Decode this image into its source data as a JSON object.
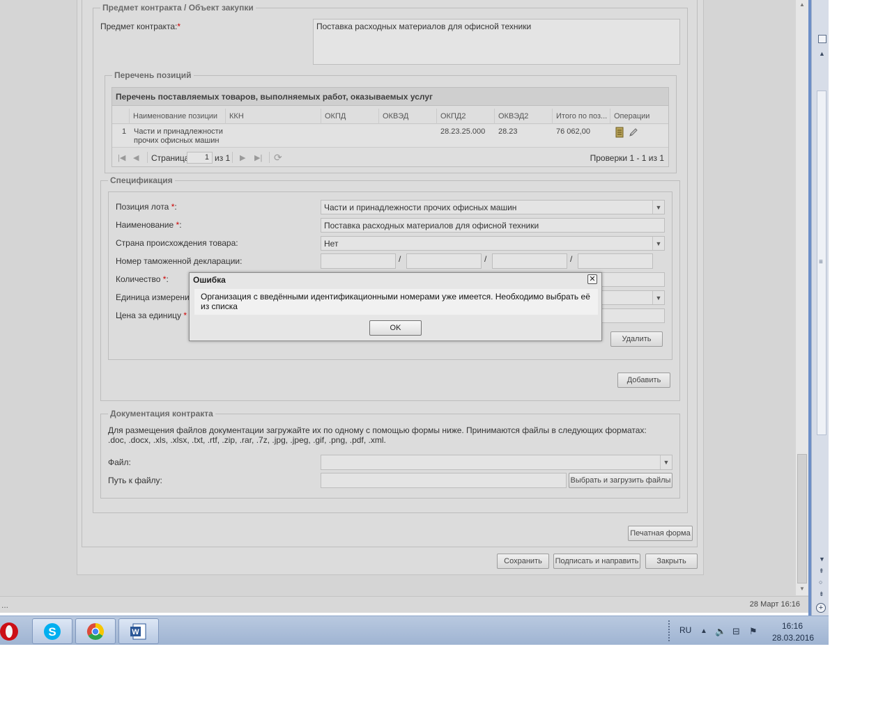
{
  "contract_subject": {
    "legend": "Предмет контракта / Объект закупки",
    "label": "Предмет контракта:",
    "required_mark": "*",
    "value": "Поставка расходных материалов для офисной техники"
  },
  "positions": {
    "legend": "Перечень позиций",
    "grid_title": "Перечень поставляемых товаров, выполняемых работ, оказываемых услуг",
    "columns": [
      "Наименование позиции",
      "ККН",
      "ОКПД",
      "ОКВЭД",
      "ОКПД2",
      "ОКВЭД2",
      "Итого по поз...",
      "Операции"
    ],
    "rows": [
      {
        "num": "1",
        "name_line1": "Части и принадлежности",
        "name_line2": "прочих офисных машин",
        "kkn": "",
        "okpd": "",
        "okved": "",
        "okpd2": "28.23.25.000",
        "okved2": "28.23",
        "total": "76 062,00"
      }
    ],
    "pager": {
      "page_label": "Страница",
      "page_value": "1",
      "of_label": "из 1",
      "summary": "Проверки 1 - 1 из 1"
    }
  },
  "spec": {
    "legend": "Спецификация",
    "lot_position_label": "Позиция лота",
    "lot_position_value": "Части и принадлежности прочих офисных машин",
    "name_label": "Наименование",
    "name_value": "Поставка расходных материалов для офисной техники",
    "country_label": "Страна происхождения товара:",
    "country_value": "Нет",
    "customs_label": "Номер таможенной декларации:",
    "customs_separator": "/",
    "quantity_label": "Количество",
    "unit_label": "Единица измерени",
    "price_label": "Цена за единицу",
    "delete_button": "Удалить",
    "add_button": "Добавить",
    "colon": ":",
    "required_mark": "*"
  },
  "docs": {
    "legend": "Документация контракта",
    "info_line1": "Для размещения файлов документации загружайте их по одному с помощью формы ниже. Принимаются файлы в следующих форматах:",
    "info_line2": ".doc, .docx, .xls, .xlsx, .txt, .rtf, .zip, .rar, .7z, .jpg, .jpeg, .gif, .png, .pdf, .xml.",
    "file_label": "Файл:",
    "path_label": "Путь к файлу:",
    "upload_button": "Выбрать и загрузить файлы"
  },
  "footer": {
    "print_button": "Печатная форма",
    "save_button": "Сохранить",
    "sign_button": "Подписать и направить",
    "close_button": "Закрыть"
  },
  "dialog": {
    "title": "Ошибка",
    "message_line1": "Организация с введёнными идентификационными номерами уже имеется. Необходимо выбрать её",
    "message_line2": "из списка",
    "ok_button": "OK",
    "close_glyph": "✕"
  },
  "status_bar": {
    "date_text": "28 Март 16:16",
    "left_dots": "..."
  },
  "taskbar": {
    "lang": "RU",
    "time": "16:16",
    "date": "28.03.2016",
    "apps": [
      "opera",
      "skype",
      "chrome",
      "word"
    ],
    "colors": {
      "opera": "#cc0f16",
      "skype": "#00aff0",
      "word": "#2b5797"
    }
  }
}
